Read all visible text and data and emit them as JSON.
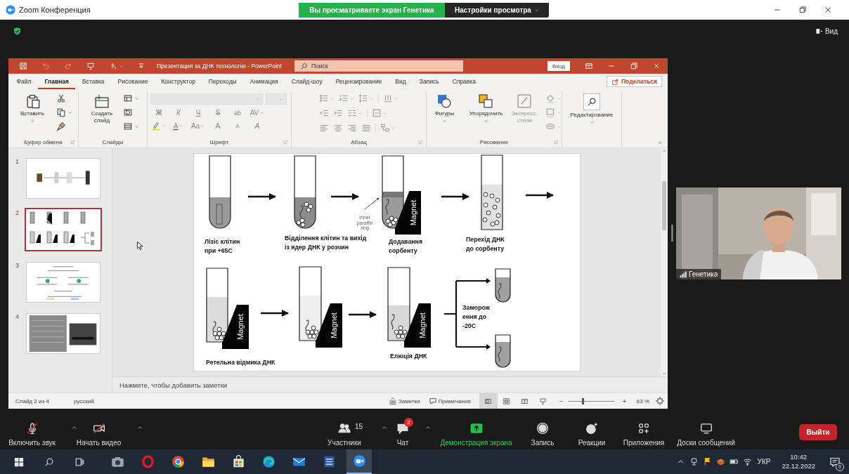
{
  "zoom_window": {
    "title": "Zoom Конференция",
    "share_notice": "Вы просматриваете экран Генетика",
    "view_options": "Настройки просмотра",
    "view_button": "Вид"
  },
  "powerpoint": {
    "title": "Презентация за ДНК технологію  -  PowerPoint",
    "search": {
      "placeholder": "Поиск"
    },
    "sign_in": "Вход",
    "tabs": [
      {
        "label": "Файл",
        "selected": false
      },
      {
        "label": "Главная",
        "selected": true
      },
      {
        "label": "Вставка",
        "selected": false
      },
      {
        "label": "Рисование",
        "selected": false
      },
      {
        "label": "Конструктор",
        "selected": false
      },
      {
        "label": "Переходы",
        "selected": false
      },
      {
        "label": "Анимация",
        "selected": false
      },
      {
        "label": "Слайд-шоу",
        "selected": false
      },
      {
        "label": "Рецензирование",
        "selected": false
      },
      {
        "label": "Вид",
        "selected": false
      },
      {
        "label": "Запись",
        "selected": false
      },
      {
        "label": "Справка",
        "selected": false
      }
    ],
    "share": "Поделиться",
    "ribbon": [
      {
        "kind": "clipboard",
        "label": "Буфер обмена",
        "buttons": [
          "Вставить"
        ]
      },
      {
        "kind": "slides",
        "label": "Слайды",
        "buttons": [
          "Создать слайд"
        ]
      },
      {
        "kind": "font",
        "label": "Шрифт",
        "buttons": [
          "Ж",
          "К",
          "Ч",
          "S",
          "ab",
          "AV",
          "A",
          "Aa",
          "A",
          "A",
          "A"
        ]
      },
      {
        "kind": "paragraph",
        "label": "Абзац"
      },
      {
        "kind": "drawing",
        "label": "Рисование",
        "buttons": [
          "Фигуры",
          "Упорядочить",
          "Экспресс-стили"
        ]
      },
      {
        "kind": "editing",
        "buttons": [
          "Редактирование"
        ]
      }
    ],
    "slides": [
      {
        "number": "1",
        "selected": false
      },
      {
        "number": "2",
        "selected": true
      },
      {
        "number": "3",
        "selected": false
      },
      {
        "number": "4",
        "selected": false
      }
    ],
    "slide": {
      "captions": [
        {
          "lines": [
            "Лізіс клітин",
            "при +65С"
          ]
        },
        {
          "lines": [
            "Відділення клітин та вихід",
            "із ядер ДНК у розчин"
          ]
        },
        {
          "lines": [
            "Додавання",
            "сорбенту"
          ]
        },
        {
          "lines": [
            "Перехід ДНК",
            "до сорбенту"
          ]
        },
        {
          "lines": [
            "Ретельна відмика ДНК"
          ]
        },
        {
          "lines": [
            "Елюція ДНК"
          ]
        },
        {
          "lines": [
            "Заморож",
            "ення до",
            "-20С"
          ]
        }
      ],
      "note": [
        "Inner",
        "paraffin",
        "ring"
      ],
      "magnets": [
        "Magnet",
        "Magnet",
        "Magnet",
        "Magnet"
      ]
    },
    "notes_placeholder": "Нажмите, чтобы добавить заметки",
    "status_bar": {
      "position": "Слайд 2 из 4",
      "language": "русский",
      "notes": "Заметки",
      "comments": "Примечания",
      "views": [
        {
          "selected": true
        },
        {
          "selected": false
        },
        {
          "selected": false
        },
        {
          "selected": false
        }
      ],
      "zoom_out": "−",
      "zoom_in": "+",
      "zoom": {
        "level": 0.32,
        "reading": "63 %"
      }
    }
  },
  "participant": {
    "name": "Генетика"
  },
  "toolbar": [
    {
      "kind": "mic",
      "label": "Включить звук",
      "muted": true
    },
    {
      "kind": "video",
      "label": "Начать видео",
      "muted": true
    },
    {
      "kind": "participants",
      "label": "Участники",
      "count": "15"
    },
    {
      "kind": "chat",
      "label": "Чат",
      "badge": "2"
    },
    {
      "kind": "share",
      "label": "Демонстрация экрана"
    },
    {
      "kind": "record",
      "label": "Запись"
    },
    {
      "kind": "reactions",
      "label": "Реакции"
    },
    {
      "kind": "apps",
      "label": "Приложения"
    },
    {
      "kind": "whiteboards",
      "label": "Доски сообщений"
    }
  ],
  "leave": "Выйти",
  "taskbar": {
    "apps": [
      {
        "kind": "camera",
        "selected": false
      },
      {
        "kind": "opera",
        "selected": false
      },
      {
        "kind": "chrome",
        "selected": false
      },
      {
        "kind": "explorer",
        "selected": false
      },
      {
        "kind": "store",
        "selected": false
      },
      {
        "kind": "edge",
        "selected": false
      },
      {
        "kind": "mail",
        "selected": false
      },
      {
        "kind": "word",
        "selected": false
      },
      {
        "kind": "zoom",
        "selected": true
      }
    ],
    "language": "УКР",
    "time": "10:42",
    "date": "22.12.2022",
    "notifications": "5"
  }
}
